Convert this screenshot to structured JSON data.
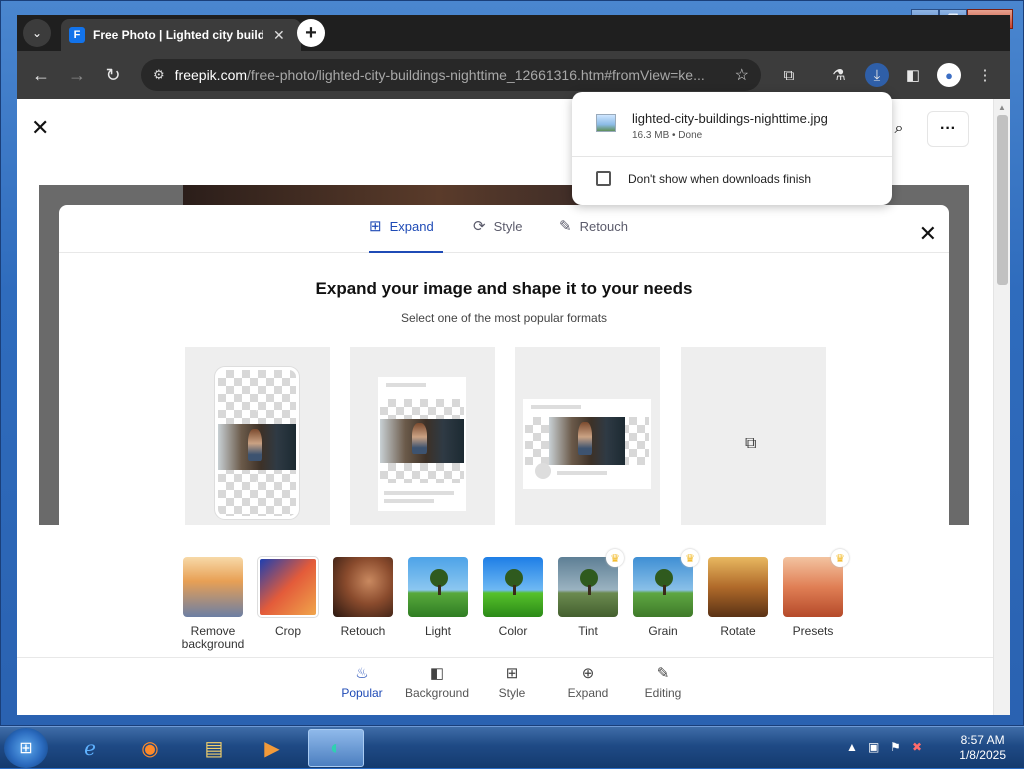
{
  "window": {
    "min": "▁",
    "max": "❐",
    "close": "✕"
  },
  "tab": {
    "favicon": "F",
    "title": "Free Photo | Lighted city buildi",
    "close": "✕",
    "menu": "⌄",
    "new": "+"
  },
  "toolbar": {
    "back": "←",
    "forward": "→",
    "reload": "↻",
    "url_host": "freepik.com",
    "url_path": "/free-photo/lighted-city-buildings-nighttime_12661316.htm#fromView=ke...",
    "star": "☆",
    "icons": [
      "extensions-icon",
      "labs-icon",
      "downloads-icon",
      "sidepanel-icon",
      "profile-icon",
      "menu-icon"
    ]
  },
  "page": {
    "close": "✕",
    "search": "⌕",
    "more": "···"
  },
  "modal": {
    "tabs": [
      {
        "label": "Expand",
        "icon": "⊞"
      },
      {
        "label": "Style",
        "icon": "⟳"
      },
      {
        "label": "Retouch",
        "icon": "✎"
      }
    ],
    "close": "✕",
    "heading": "Expand your image and shape it to your needs",
    "subheading": "Select one of the most popular formats"
  },
  "tools": [
    {
      "label": "Remove background",
      "premium": false
    },
    {
      "label": "Crop",
      "premium": false
    },
    {
      "label": "Retouch",
      "premium": false
    },
    {
      "label": "Light",
      "premium": false
    },
    {
      "label": "Color",
      "premium": false
    },
    {
      "label": "Tint",
      "premium": true
    },
    {
      "label": "Grain",
      "premium": true
    },
    {
      "label": "Rotate",
      "premium": false
    },
    {
      "label": "Presets",
      "premium": true
    }
  ],
  "bottom_tabs": [
    {
      "label": "Popular",
      "icon": "♨",
      "active": true
    },
    {
      "label": "Background",
      "icon": "◧",
      "active": false
    },
    {
      "label": "Style",
      "icon": "⊞",
      "active": false
    },
    {
      "label": "Expand",
      "icon": "⊕",
      "active": false
    },
    {
      "label": "Editing",
      "icon": "✎",
      "active": false
    }
  ],
  "download": {
    "filename": "lighted-city-buildings-nighttime.jpg",
    "meta": "16.3 MB • Done",
    "checkbox_label": "Don't show when downloads finish"
  },
  "taskbar": {
    "start": "⊞",
    "apps": [
      "internet-explorer-icon",
      "firefox-icon",
      "file-explorer-icon",
      "media-player-icon",
      "chrome-icon"
    ],
    "time": "8:57 AM",
    "date": "1/8/2025",
    "tray_arrow": "▲"
  }
}
